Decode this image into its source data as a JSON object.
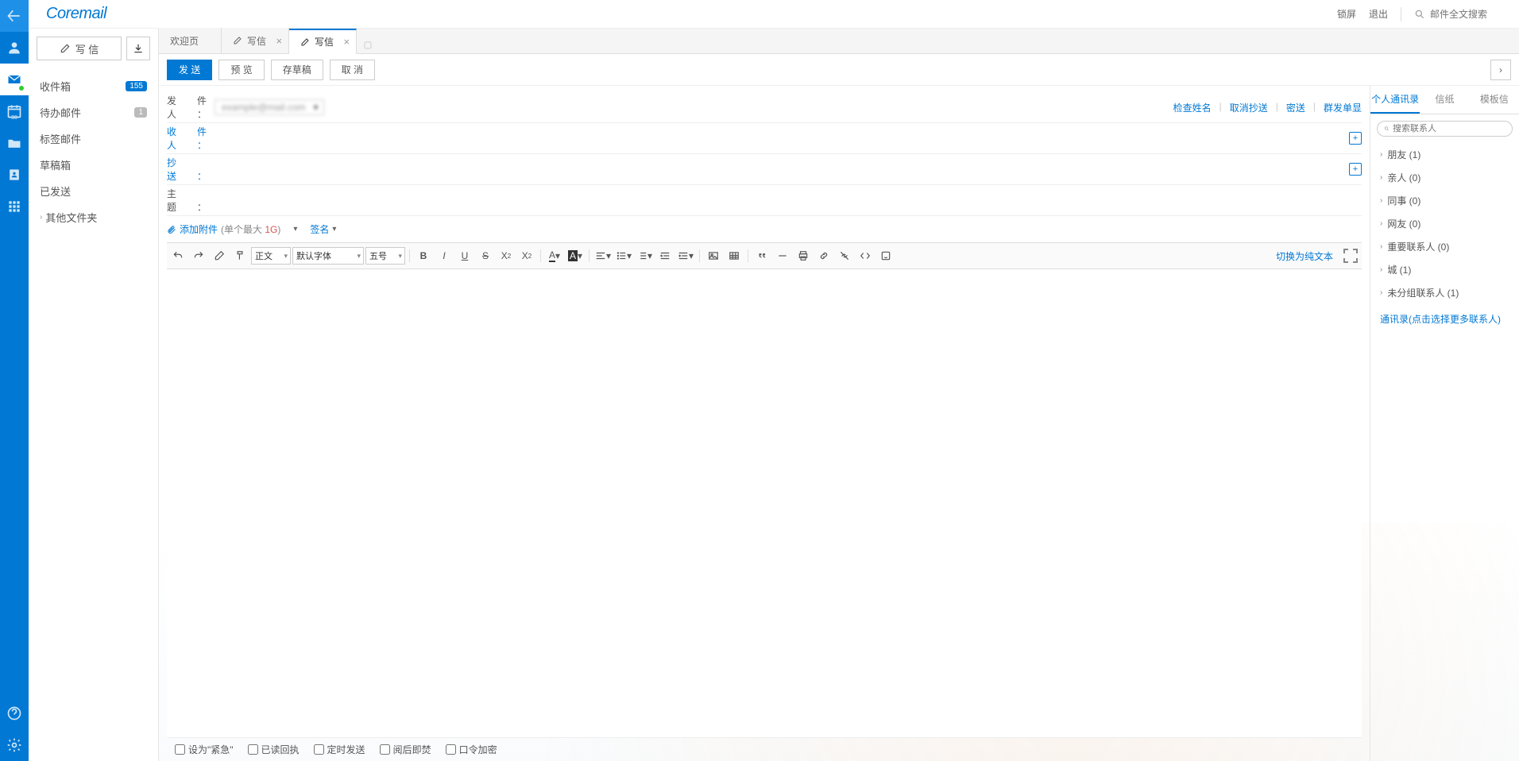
{
  "brand": "Coremail",
  "topbar": {
    "lock": "锁屏",
    "logout": "退出",
    "search_placeholder": "邮件全文搜索"
  },
  "rail": {
    "back": "返回",
    "profile": "个人",
    "mail": "邮件",
    "calendar": "日历",
    "files": "文件",
    "contacts": "通讯录",
    "apps": "应用",
    "help": "帮助",
    "settings": "设置"
  },
  "sidebar": {
    "compose": "写 信",
    "folders": [
      {
        "name": "收件箱",
        "badge": "155",
        "badge_color": "blue"
      },
      {
        "name": "待办邮件",
        "badge": "1",
        "badge_color": "gray"
      },
      {
        "name": "标签邮件"
      },
      {
        "name": "草稿箱"
      },
      {
        "name": "已发送"
      }
    ],
    "other": "其他文件夹"
  },
  "tabs": [
    {
      "label": "欢迎页",
      "icon": false,
      "closable": false
    },
    {
      "label": "写信",
      "icon": true,
      "closable": true
    },
    {
      "label": "写信",
      "icon": true,
      "closable": true,
      "active": true
    }
  ],
  "actions": {
    "send": "发 送",
    "preview": "预 览",
    "draft": "存草稿",
    "cancel": "取 消"
  },
  "fields": {
    "from_label": "发件人：",
    "from_value": "example@mail.com",
    "check_name": "检查姓名",
    "cancel_cc": "取消抄送",
    "bcc": "密送",
    "mass": "群发单显",
    "to_label": "收件人：",
    "cc_label": "抄　送：",
    "subject_label": "主　题："
  },
  "attach": {
    "add": "添加附件",
    "size_prefix": "(单个最大 ",
    "size_val": "1G",
    "size_suffix": ")",
    "sign": "签名"
  },
  "toolbar": {
    "format": "正文",
    "font": "默认字体",
    "size": "五号",
    "plain": "切换为纯文本"
  },
  "bottom": {
    "urgent": "设为\"紧急\"",
    "receipt": "已读回执",
    "schedule": "定时发送",
    "burn": "阅后即焚",
    "encrypt": "口令加密"
  },
  "contacts": {
    "tab_personal": "个人通讯录",
    "tab_paper": "信纸",
    "tab_template": "模板信",
    "search_placeholder": "搜索联系人",
    "groups": [
      {
        "label": "朋友 (1)"
      },
      {
        "label": "亲人 (0)"
      },
      {
        "label": "同事 (0)"
      },
      {
        "label": "网友 (0)"
      },
      {
        "label": "重要联系人 (0)"
      },
      {
        "label": "城 (1)"
      },
      {
        "label": "未分组联系人 (1)"
      }
    ],
    "more": "通讯录(点击选择更多联系人)"
  }
}
